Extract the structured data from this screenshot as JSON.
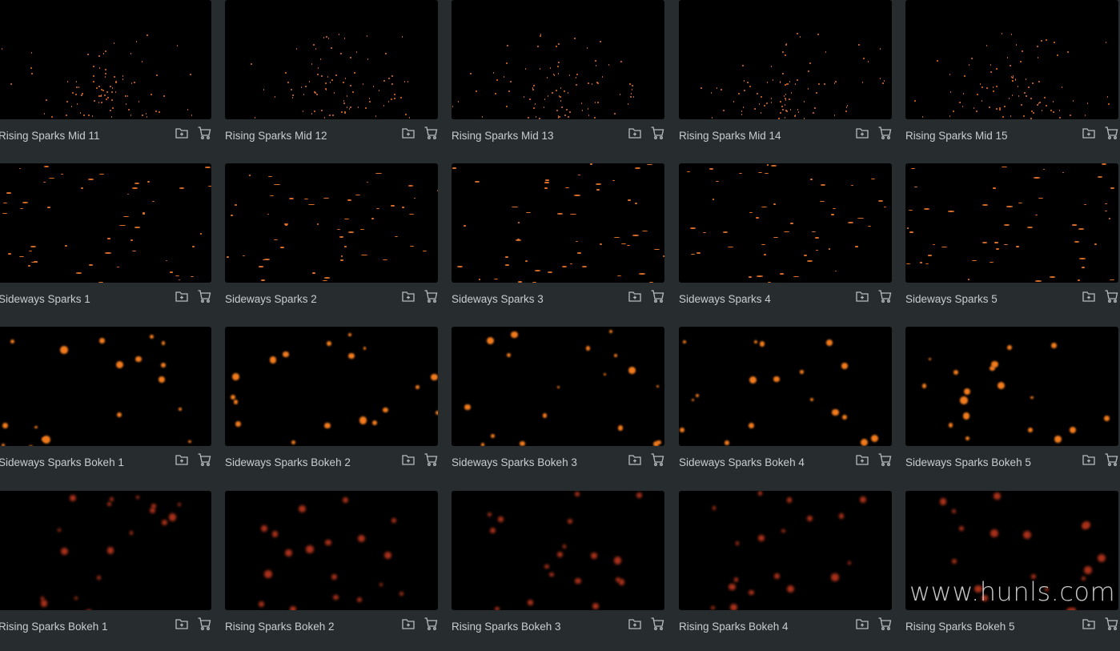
{
  "colors": {
    "background": "#272c2f",
    "spark": "#ff7a1a"
  },
  "rows": [
    {
      "style": "rising",
      "items": [
        "Rising Sparks Mid 11",
        "Rising Sparks Mid 12",
        "Rising Sparks Mid 13",
        "Rising Sparks Mid 14",
        "Rising Sparks Mid 15"
      ]
    },
    {
      "style": "sideways",
      "items": [
        "Sideways Sparks 1",
        "Sideways Sparks 2",
        "Sideways Sparks 3",
        "Sideways Sparks 4",
        "Sideways Sparks 5"
      ]
    },
    {
      "style": "bokeh",
      "items": [
        "Sideways Sparks Bokeh 1",
        "Sideways Sparks Bokeh 2",
        "Sideways Sparks Bokeh 3",
        "Sideways Sparks Bokeh 4",
        "Sideways Sparks Bokeh 5"
      ]
    },
    {
      "style": "bokeh-dim",
      "items": [
        "Rising Sparks Bokeh 1",
        "Rising Sparks Bokeh 2",
        "Rising Sparks Bokeh 3",
        "Rising Sparks Bokeh 4",
        "Rising Sparks Bokeh 5"
      ]
    }
  ],
  "icons": {
    "add": "folder-plus-icon",
    "cart": "cart-icon"
  },
  "watermark": "www.hunls.com"
}
